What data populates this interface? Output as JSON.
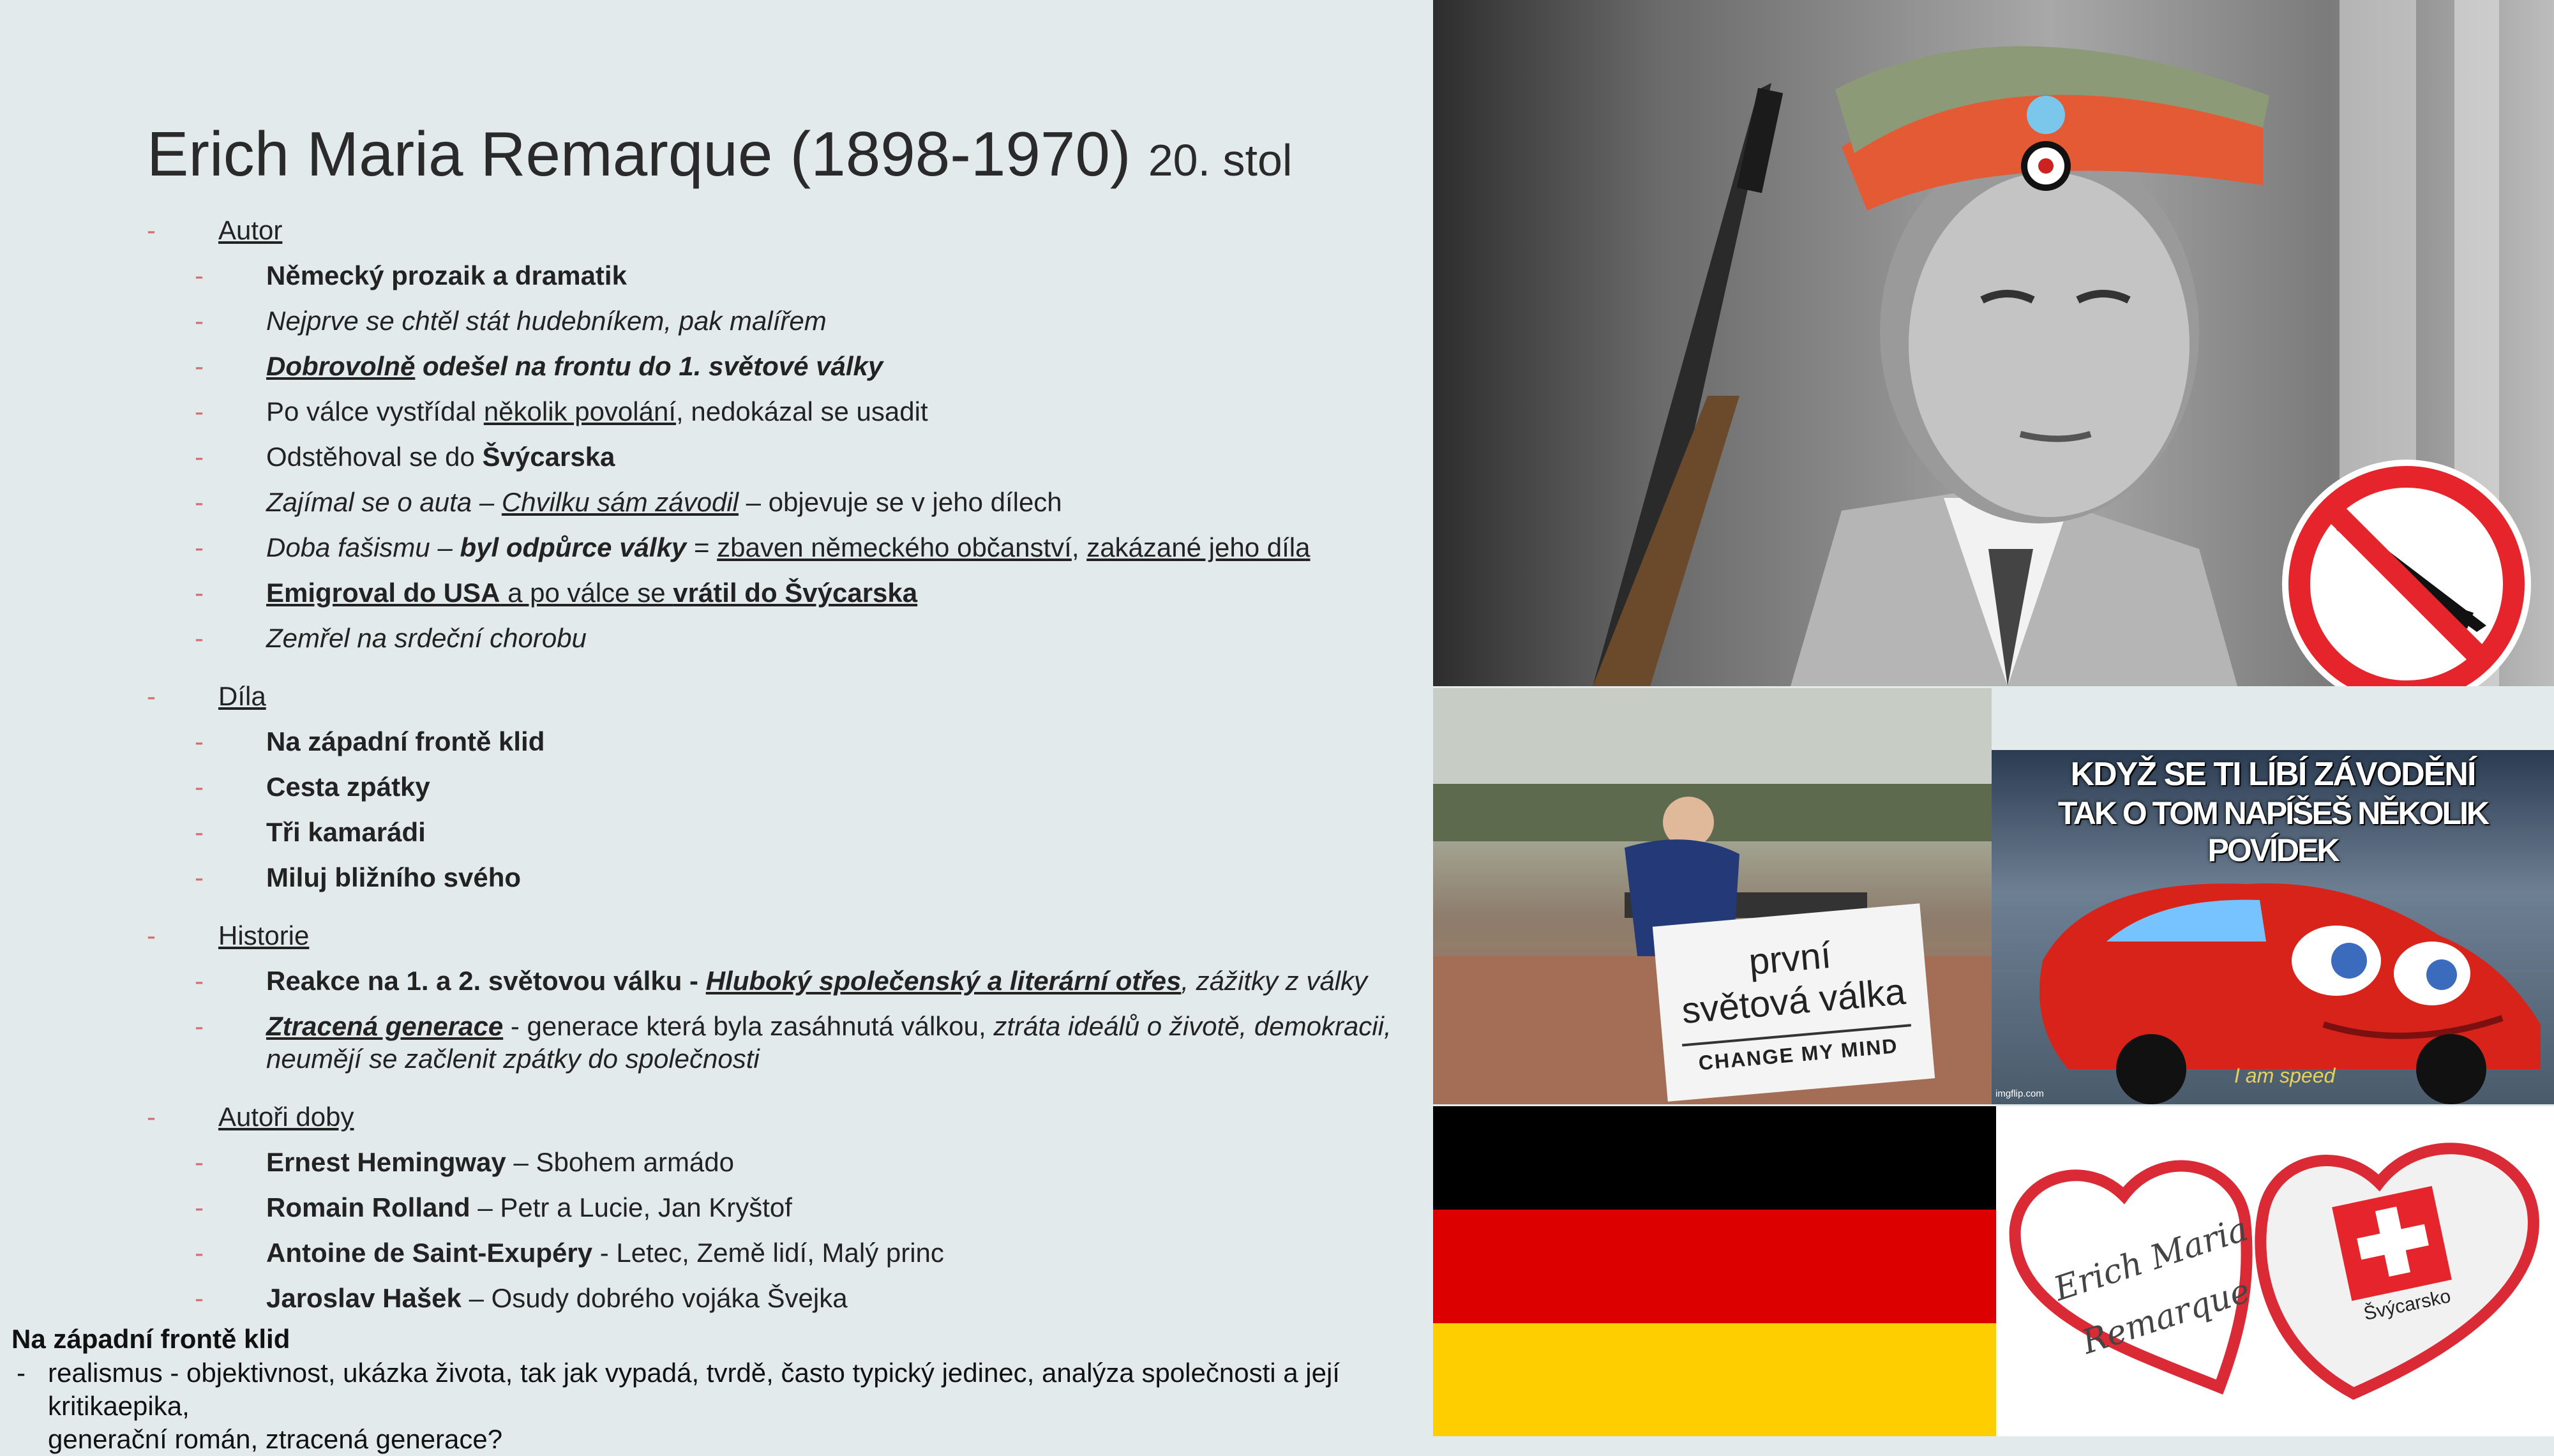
{
  "slide": {
    "title": "Erich Maria Remarque (1898-1970)",
    "title_suffix": "20. stol",
    "bullet_marker": "-"
  },
  "sections": {
    "autor": {
      "heading": "Autor",
      "items": {
        "i1": {
          "a": "Německý prozaik a dramatik"
        },
        "i2": {
          "a": "Nejprve se chtěl stát hudebníkem, pak malířem"
        },
        "i3": {
          "a": "Dobrovolně",
          "b": " odešel na frontu do 1. světové války"
        },
        "i4": {
          "a": "Po válce vystřídal ",
          "b": "několik povolání",
          "c": ", nedokázal se usadit"
        },
        "i5": {
          "a": "Odstěhoval se do ",
          "b": "Švýcarska"
        },
        "i6": {
          "a": "Zajímal se o auta – ",
          "b": "Chvilku sám závodil",
          "c": " – objevuje se v jeho dílech"
        },
        "i7": {
          "a": "Doba fašismu – ",
          "b": "byl odpůrce války",
          "c": " = ",
          "d": "zbaven německého občanství",
          "e": ", ",
          "f": "zakázané jeho díla"
        },
        "i8": {
          "a": "Emigroval do USA",
          "b": " a po válce se ",
          "c": "vrátil do Švýcarska"
        },
        "i9": {
          "a": "Zemřel na srdeční chorobu"
        }
      }
    },
    "dila": {
      "heading": "Díla",
      "items": [
        "Na západní frontě klid",
        "Cesta zpátky",
        "Tři kamarádi",
        "Miluj bližního svého"
      ]
    },
    "historie": {
      "heading": "Historie",
      "items": {
        "h1": {
          "a": "Reakce na 1. a 2. světovou válku - ",
          "b": "Hluboký společenský a literární otřes",
          "c": ", zážitky z války"
        },
        "h2": {
          "a": "Ztracená generace",
          "b": " - generace která byla zasáhnutá válkou, ",
          "c": "ztráta ideálů o životě, demokracii, neumějí se začlenit zpátky do společnosti"
        }
      }
    },
    "autori": {
      "heading": "Autoři doby",
      "items": [
        {
          "name": "Ernest Hemingway",
          "rest": " – Sbohem armádo"
        },
        {
          "name": "Romain Rolland",
          "rest": " – Petr a Lucie, Jan Kryštof"
        },
        {
          "name": "Antoine de Saint-Exupéry",
          "rest": " -  Letec, Země lidí, Malý princ"
        },
        {
          "name": "Jaroslav Hašek",
          "rest": " – Osudy dobrého vojáka Švejka"
        }
      ]
    }
  },
  "bottom": {
    "heading": "Na západní frontě klid",
    "line1": "realismus - objektivnost, ukázka života, tak jak vypadá, tvrdě, často typický jedinec, analýza společnosti a její kritikaepika,",
    "line2": "generační román, ztracená generace?"
  },
  "images": {
    "portrait_icon": "portrait-photo",
    "meme_sign_line1": "první",
    "meme_sign_line2": "světová válka",
    "meme_sign_footer": "CHANGE MY MIND",
    "cars_caption_line1": "KDYŽ SE TI LÍBÍ ZÁVODĚNÍ",
    "cars_caption_line2": "TAK O TOM NAPÍŠEŠ NĚKOLIK POVÍDEK",
    "cars_quote": "I am speed",
    "imgflip": "imgflip.com",
    "heart_text_line1": "Erich Maria",
    "heart_text_line2": "Remarque",
    "swiss_label": "Švýcarsko",
    "flag_colors": [
      "#000000",
      "#dd0000",
      "#ffce00"
    ],
    "swiss_red": "#e5242b"
  }
}
